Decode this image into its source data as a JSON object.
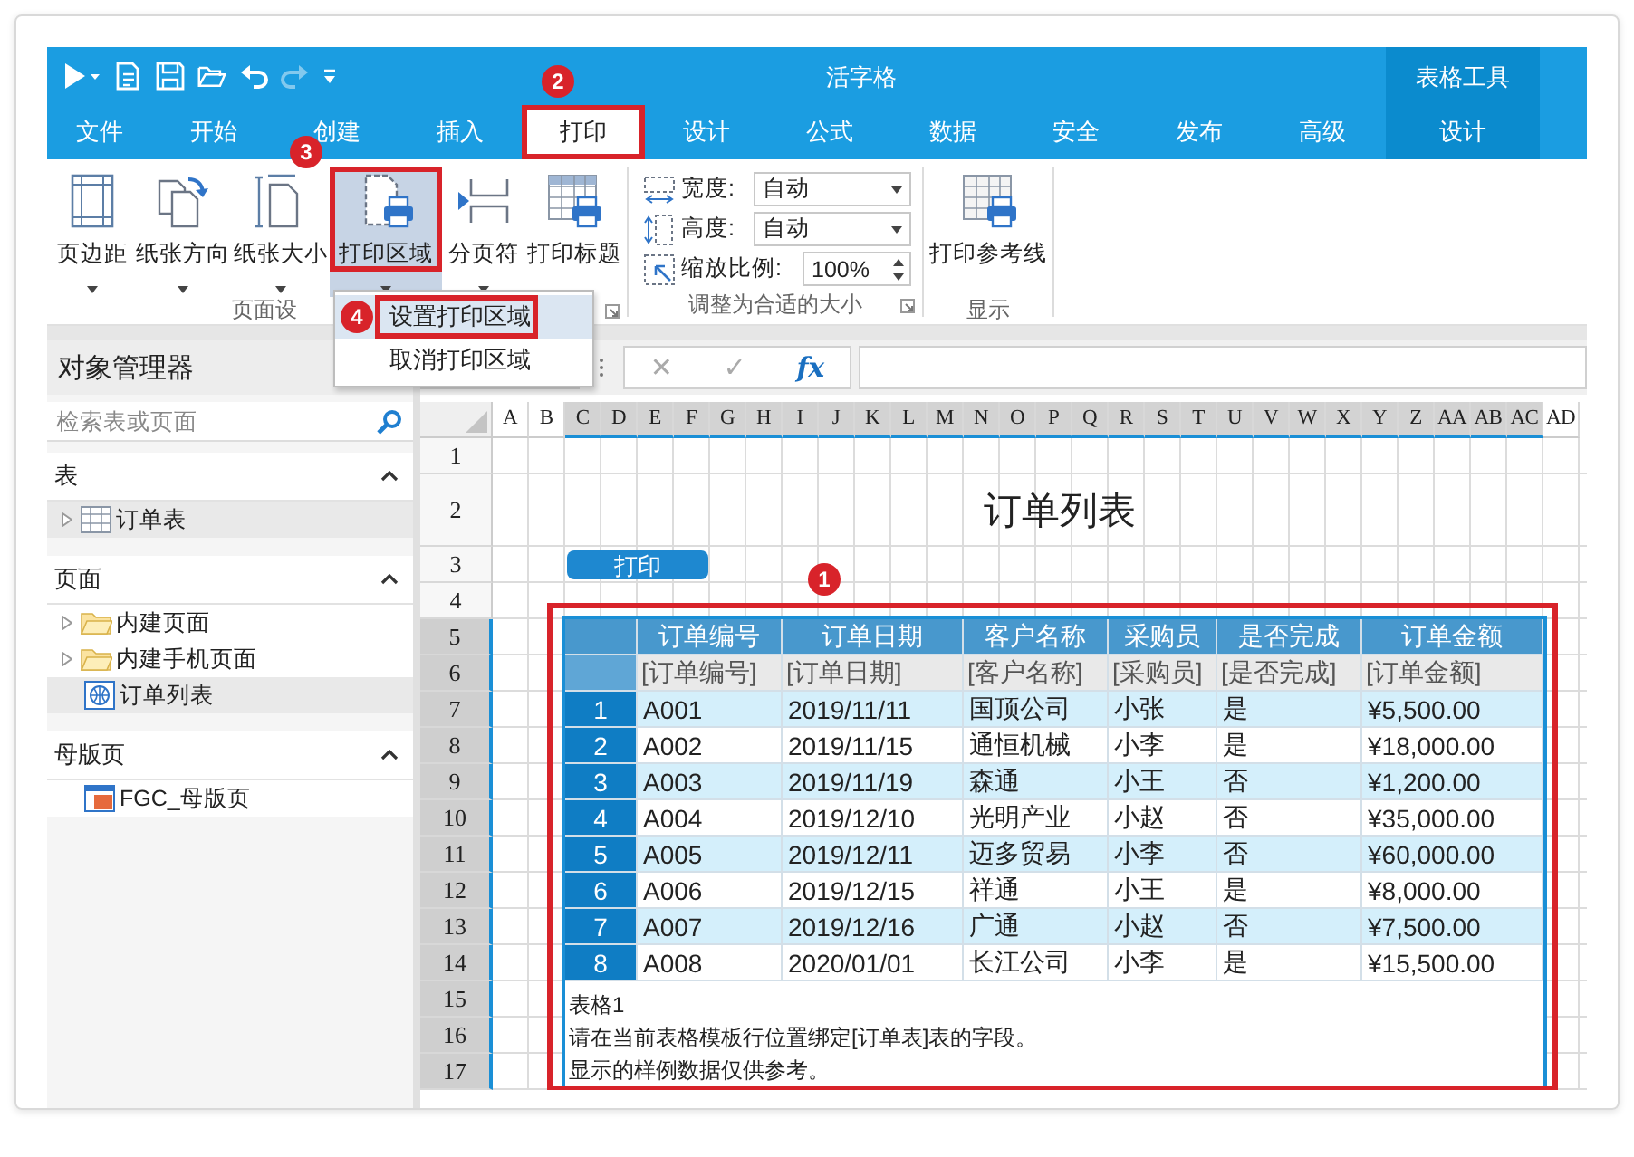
{
  "window": {
    "title": "活字格"
  },
  "quick_access": [
    {
      "kind": "run",
      "disabled": false
    },
    {
      "kind": "new",
      "disabled": false
    },
    {
      "kind": "save",
      "disabled": false
    },
    {
      "kind": "open",
      "disabled": false
    },
    {
      "kind": "undo",
      "disabled": false
    },
    {
      "kind": "redo",
      "disabled": true
    },
    {
      "kind": "customize",
      "disabled": false
    }
  ],
  "context_group": {
    "label": "表格工具"
  },
  "tabs": [
    {
      "label": "文件",
      "selected": false,
      "contextual": false
    },
    {
      "label": "开始",
      "selected": false,
      "contextual": false
    },
    {
      "label": "创建",
      "selected": false,
      "contextual": false
    },
    {
      "label": "插入",
      "selected": false,
      "contextual": false
    },
    {
      "label": "打印",
      "selected": true,
      "contextual": false,
      "callout": "2"
    },
    {
      "label": "设计",
      "selected": false,
      "contextual": false
    },
    {
      "label": "公式",
      "selected": false,
      "contextual": false
    },
    {
      "label": "数据",
      "selected": false,
      "contextual": false
    },
    {
      "label": "安全",
      "selected": false,
      "contextual": false
    },
    {
      "label": "发布",
      "selected": false,
      "contextual": false
    },
    {
      "label": "高级",
      "selected": false,
      "contextual": false
    },
    {
      "label": "设计",
      "selected": false,
      "contextual": true
    }
  ],
  "ribbon": {
    "groups": [
      {
        "kind": "buttons",
        "label": "页面设",
        "launcher": true,
        "buttons": [
          {
            "label": "页边距",
            "kind": "margins",
            "pressed": false,
            "has_dropdown": true
          },
          {
            "label": "纸张方向",
            "kind": "orientation",
            "pressed": false,
            "has_dropdown": true
          },
          {
            "label": "纸张大小",
            "kind": "size",
            "pressed": false,
            "has_dropdown": true
          },
          {
            "label": "打印区域",
            "kind": "print_area",
            "pressed": true,
            "has_dropdown": true,
            "callout": "3",
            "menu": [
              {
                "label": "设置打印区域",
                "selected": true,
                "callout": "4"
              },
              {
                "label": "取消打印区域",
                "selected": false
              }
            ]
          },
          {
            "label": "分页符",
            "kind": "page_break",
            "pressed": false,
            "has_dropdown": true
          },
          {
            "label": "打印标题",
            "kind": "print_titles",
            "pressed": false,
            "has_dropdown": false
          }
        ]
      },
      {
        "kind": "fields",
        "label": "调整为合适的大小",
        "launcher": true,
        "fields": [
          {
            "kind": "width",
            "label": "宽度:",
            "value": "自动",
            "spinner": false
          },
          {
            "kind": "height",
            "label": "高度:",
            "value": "自动",
            "spinner": false
          },
          {
            "kind": "scale",
            "label": "缩放比例:",
            "value": "100%",
            "spinner": true
          }
        ]
      },
      {
        "kind": "buttons",
        "label": "显示",
        "launcher": false,
        "buttons": [
          {
            "label": "打印参考线",
            "kind": "gridlines",
            "pressed": false,
            "has_dropdown": false
          }
        ]
      }
    ]
  },
  "formula_bar": {
    "buttons": [
      {
        "label": "✕",
        "disabled": true
      },
      {
        "label": "✓",
        "disabled": true
      },
      {
        "label": "fx",
        "disabled": false
      }
    ]
  },
  "object_manager": {
    "title": "对象管理器",
    "search": {
      "placeholder": "检索表或页面"
    },
    "sections": [
      {
        "title": "表",
        "expanded": true,
        "items": [
          {
            "label": "订单表",
            "kind": "table",
            "expandable": true,
            "selected": true
          }
        ]
      },
      {
        "title": "页面",
        "expanded": true,
        "items": [
          {
            "label": "内建页面",
            "kind": "folder",
            "expandable": true,
            "selected": false
          },
          {
            "label": "内建手机页面",
            "kind": "folder",
            "expandable": true,
            "selected": false
          },
          {
            "label": "订单列表",
            "kind": "page",
            "expandable": false,
            "selected": true
          }
        ]
      },
      {
        "title": "母版页",
        "expanded": true,
        "items": [
          {
            "label": "FGC_母版页",
            "kind": "master",
            "expandable": false,
            "selected": false
          }
        ]
      }
    ]
  },
  "sheet": {
    "columns": [
      {
        "label": "A",
        "selected": false
      },
      {
        "label": "B",
        "selected": false
      },
      {
        "label": "C",
        "selected": true
      },
      {
        "label": "D",
        "selected": true
      },
      {
        "label": "E",
        "selected": true
      },
      {
        "label": "F",
        "selected": true
      },
      {
        "label": "G",
        "selected": true
      },
      {
        "label": "H",
        "selected": true
      },
      {
        "label": "I",
        "selected": true
      },
      {
        "label": "J",
        "selected": true
      },
      {
        "label": "K",
        "selected": true
      },
      {
        "label": "L",
        "selected": true
      },
      {
        "label": "M",
        "selected": true
      },
      {
        "label": "N",
        "selected": true
      },
      {
        "label": "O",
        "selected": true
      },
      {
        "label": "P",
        "selected": true
      },
      {
        "label": "Q",
        "selected": true
      },
      {
        "label": "R",
        "selected": true
      },
      {
        "label": "S",
        "selected": true
      },
      {
        "label": "T",
        "selected": true
      },
      {
        "label": "U",
        "selected": true
      },
      {
        "label": "V",
        "selected": true
      },
      {
        "label": "W",
        "selected": true
      },
      {
        "label": "X",
        "selected": true
      },
      {
        "label": "Y",
        "selected": true
      },
      {
        "label": "Z",
        "selected": true
      },
      {
        "label": "AA",
        "selected": true
      },
      {
        "label": "AB",
        "selected": true
      },
      {
        "label": "AC",
        "selected": true
      },
      {
        "label": "AD",
        "selected": false
      }
    ],
    "rows": [
      {
        "label": "1",
        "selected": false
      },
      {
        "label": "2",
        "selected": false
      },
      {
        "label": "3",
        "selected": false
      },
      {
        "label": "4",
        "selected": false
      },
      {
        "label": "5",
        "selected": true
      },
      {
        "label": "6",
        "selected": true
      },
      {
        "label": "7",
        "selected": true
      },
      {
        "label": "8",
        "selected": true
      },
      {
        "label": "9",
        "selected": true
      },
      {
        "label": "10",
        "selected": true
      },
      {
        "label": "11",
        "selected": true
      },
      {
        "label": "12",
        "selected": true
      },
      {
        "label": "13",
        "selected": true
      },
      {
        "label": "14",
        "selected": true
      },
      {
        "label": "15",
        "selected": true
      },
      {
        "label": "16",
        "selected": true
      },
      {
        "label": "17",
        "selected": true
      }
    ],
    "title": "订单列表",
    "print_button": {
      "label": "打印"
    },
    "table": {
      "callout": "1",
      "columns": [
        "订单编号",
        "订单日期",
        "客户名称",
        "采购员",
        "是否完成",
        "订单金额"
      ],
      "bindings": [
        "[订单编号]",
        "[订单日期]",
        "[客户名称]",
        "[采购员]",
        "[是否完成]",
        "[订单金额]"
      ],
      "rows": [
        {
          "index": "1",
          "cells": [
            "A001",
            "2019/11/11",
            "国顶公司",
            "小张",
            "是",
            "¥5,500.00"
          ]
        },
        {
          "index": "2",
          "cells": [
            "A002",
            "2019/11/15",
            "通恒机械",
            "小李",
            "是",
            "¥18,000.00"
          ]
        },
        {
          "index": "3",
          "cells": [
            "A003",
            "2019/11/19",
            "森通",
            "小王",
            "否",
            "¥1,200.00"
          ]
        },
        {
          "index": "4",
          "cells": [
            "A004",
            "2019/12/10",
            "光明产业",
            "小赵",
            "否",
            "¥35,000.00"
          ]
        },
        {
          "index": "5",
          "cells": [
            "A005",
            "2019/12/11",
            "迈多贸易",
            "小李",
            "否",
            "¥60,000.00"
          ]
        },
        {
          "index": "6",
          "cells": [
            "A006",
            "2019/12/15",
            "祥通",
            "小王",
            "是",
            "¥8,000.00"
          ]
        },
        {
          "index": "7",
          "cells": [
            "A007",
            "2019/12/16",
            "广通",
            "小赵",
            "否",
            "¥7,500.00"
          ]
        },
        {
          "index": "8",
          "cells": [
            "A008",
            "2020/01/01",
            "长江公司",
            "小李",
            "是",
            "¥15,500.00"
          ]
        }
      ],
      "notes": [
        "表格1",
        "请在当前表格模板行位置绑定[订单表]表的字段。",
        "显示的样例数据仅供参考。"
      ]
    }
  }
}
